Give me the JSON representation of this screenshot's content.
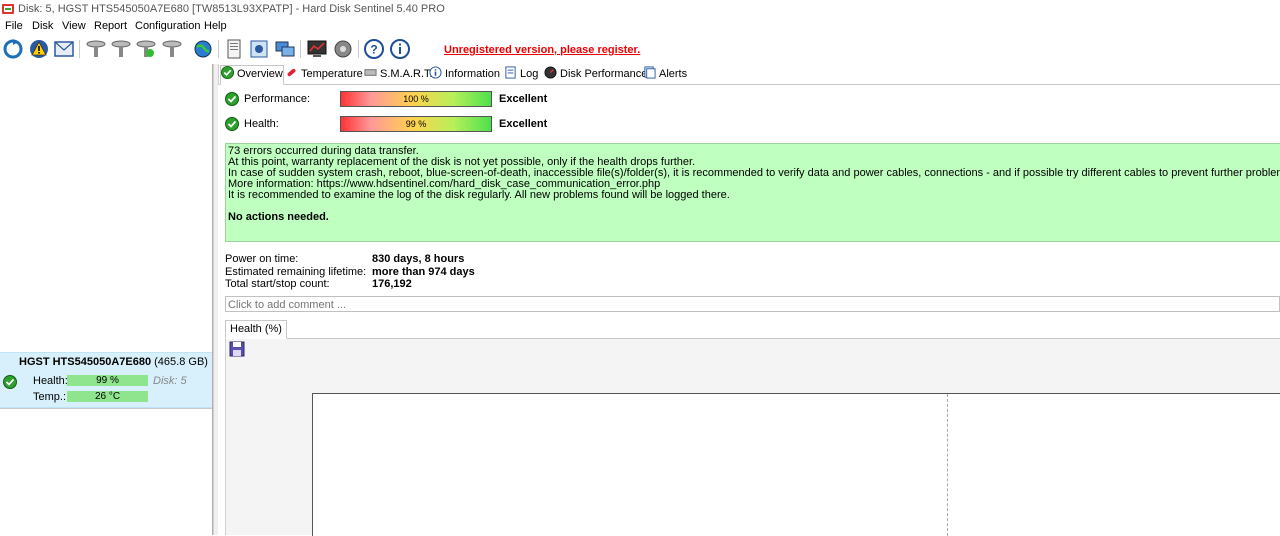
{
  "window": {
    "title": "Disk: 5, HGST HTS545050A7E680 [TW8513L93XPATP]  -  Hard Disk Sentinel 5.40 PRO"
  },
  "menu": [
    "File",
    "Disk",
    "View",
    "Report",
    "Configuration",
    "Help"
  ],
  "toolbar": {
    "register_text": "Unregistered version, please register."
  },
  "disk_card": {
    "name": "HGST HTS545050A7E680",
    "capacity": "(465.8 GB)",
    "health_label": "Health:",
    "health_value": "99 %",
    "disk_label": "Disk: 5",
    "temp_label": "Temp.:",
    "temp_value": "26 °C",
    "health_fraction": 0.99
  },
  "tabs": [
    "Overview",
    "Temperature",
    "S.M.A.R.T.",
    "Information",
    "Log",
    "Disk Performance",
    "Alerts"
  ],
  "performance": {
    "label": "Performance:",
    "value": "100 %",
    "rating": "Excellent"
  },
  "health": {
    "label": "Health:",
    "value": "99 %",
    "rating": "Excellent"
  },
  "message": {
    "lines": [
      "73 errors occurred during data transfer.",
      "At this point, warranty replacement of the disk is not yet possible, only if the health drops further.",
      "In case of sudden system crash, reboot, blue-screen-of-death, inaccessible file(s)/folder(s), it is recommended to verify data and power cables, connections - and if possible try different cables to prevent further problems.",
      "More information: https://www.hdsentinel.com/hard_disk_case_communication_error.php",
      "It is recommended to examine the log of the disk regularly. All new problems found will be logged there."
    ],
    "action": "No actions needed."
  },
  "stats": [
    {
      "key": "Power on time:",
      "value": "830 days, 8 hours"
    },
    {
      "key": "Estimated remaining lifetime:",
      "value": "more than 974 days"
    },
    {
      "key": "Total start/stop count:",
      "value": "176,192"
    }
  ],
  "comment": {
    "placeholder": "Click to add comment ..."
  },
  "chart_tab": "Health (%)",
  "colors": {
    "accent_red": "#e00000",
    "message_bg": "#bfffbf",
    "selection_bg": "#d8f0fb",
    "bar_green": "#8ee58e"
  }
}
